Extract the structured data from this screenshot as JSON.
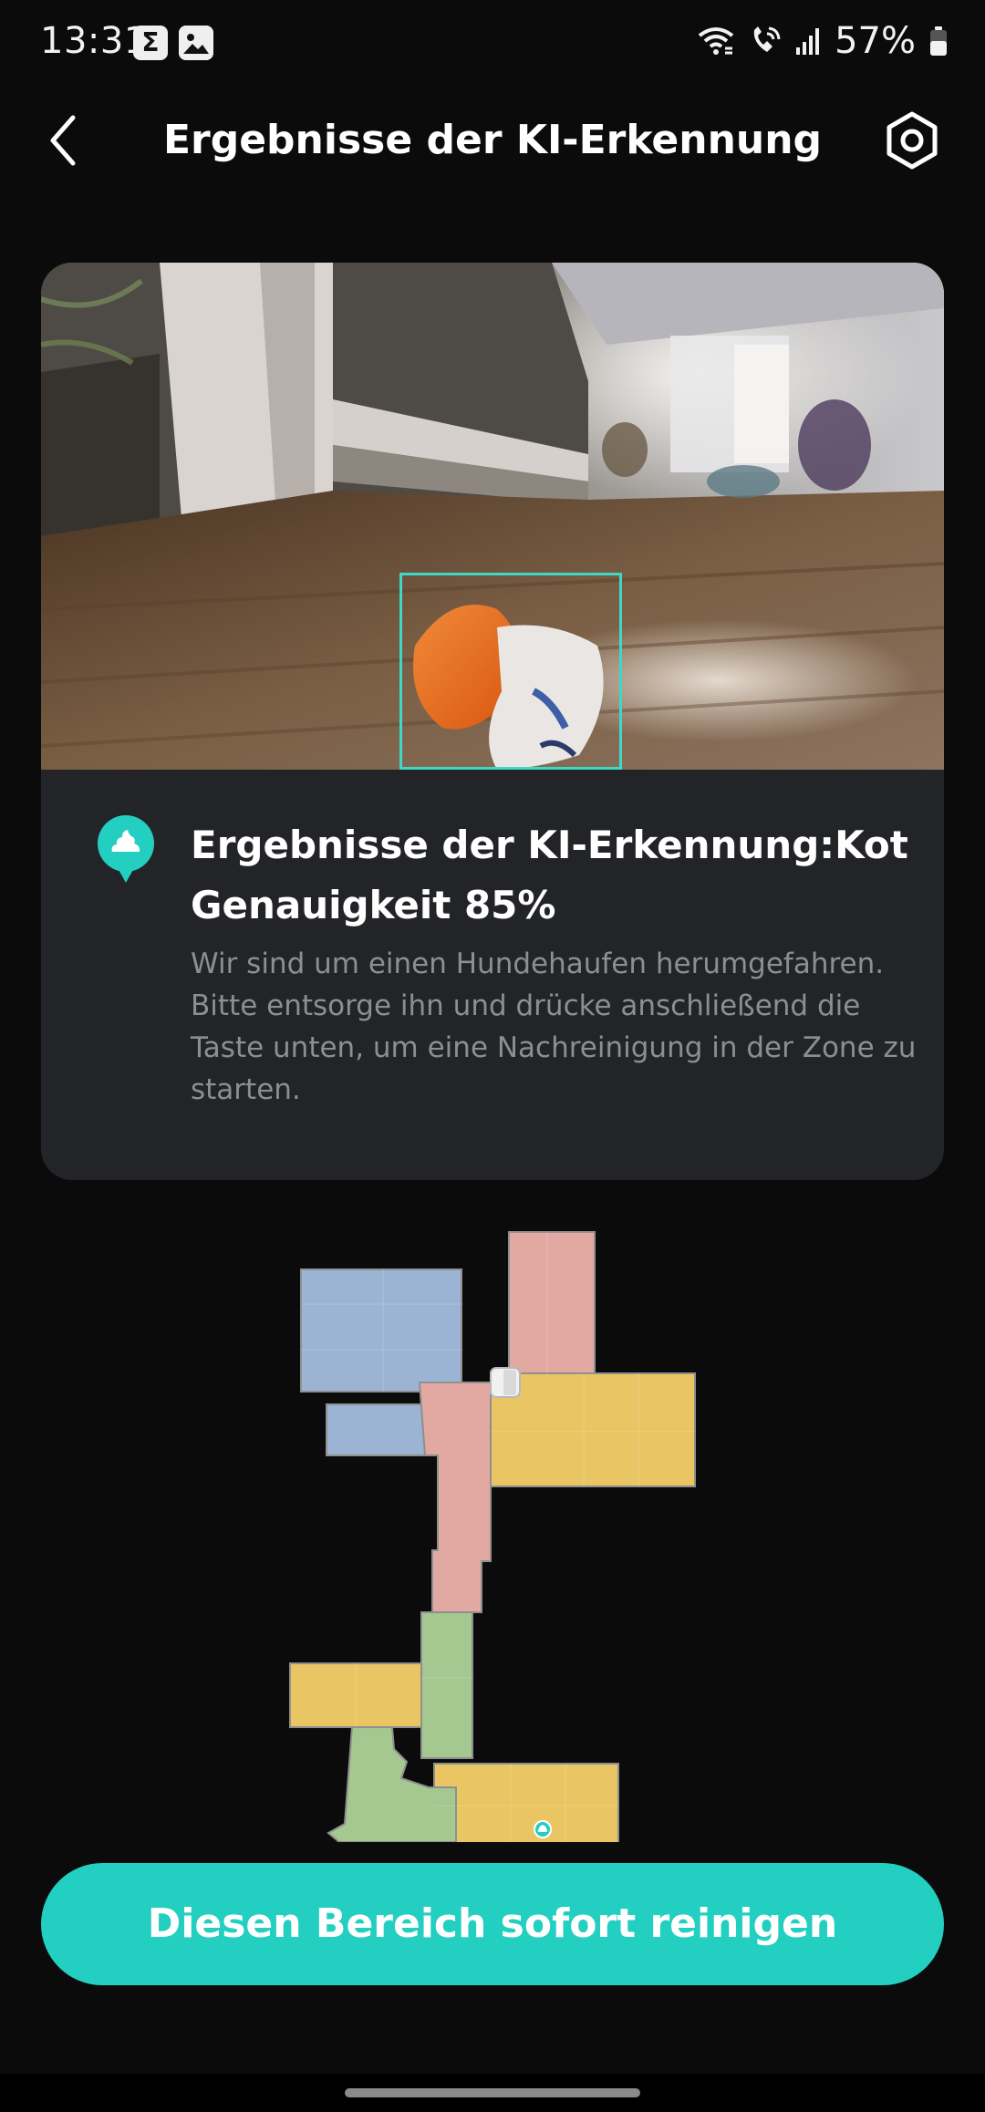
{
  "status_bar": {
    "time": "13:31",
    "notification_icons": [
      "sigma-icon",
      "image-icon"
    ],
    "signal_icons": [
      "wifi-icon",
      "wifi-calling-icon",
      "cell-signal-icon"
    ],
    "battery_percent": "57%",
    "battery_level": 0.57
  },
  "header": {
    "title": "Ergebnisse der KI-Erkennung",
    "back_icon": "chevron-left-icon",
    "settings_icon": "hexagon-settings-icon"
  },
  "result": {
    "title_line1": "Ergebnisse der KI-Erkennung:Kot",
    "title_line2": "Genauigkeit 85%",
    "accuracy_percent": 85,
    "description": "Wir sind um einen Hundehaufen herumgefahren. Bitte entsorge ihn und drücke anschließend die Taste unten, um eine Nachreinigung in der Zone zu starten.",
    "detection_icon": "poop-icon",
    "accent_color": "#22cfc0"
  },
  "map": {
    "room_colors": {
      "blue": "#9cb4d4",
      "pink": "#e2a9a2",
      "yellow": "#e9c563",
      "green": "#a4c88f"
    }
  },
  "actions": {
    "clean_button_label": "Diesen Bereich sofort reinigen"
  }
}
